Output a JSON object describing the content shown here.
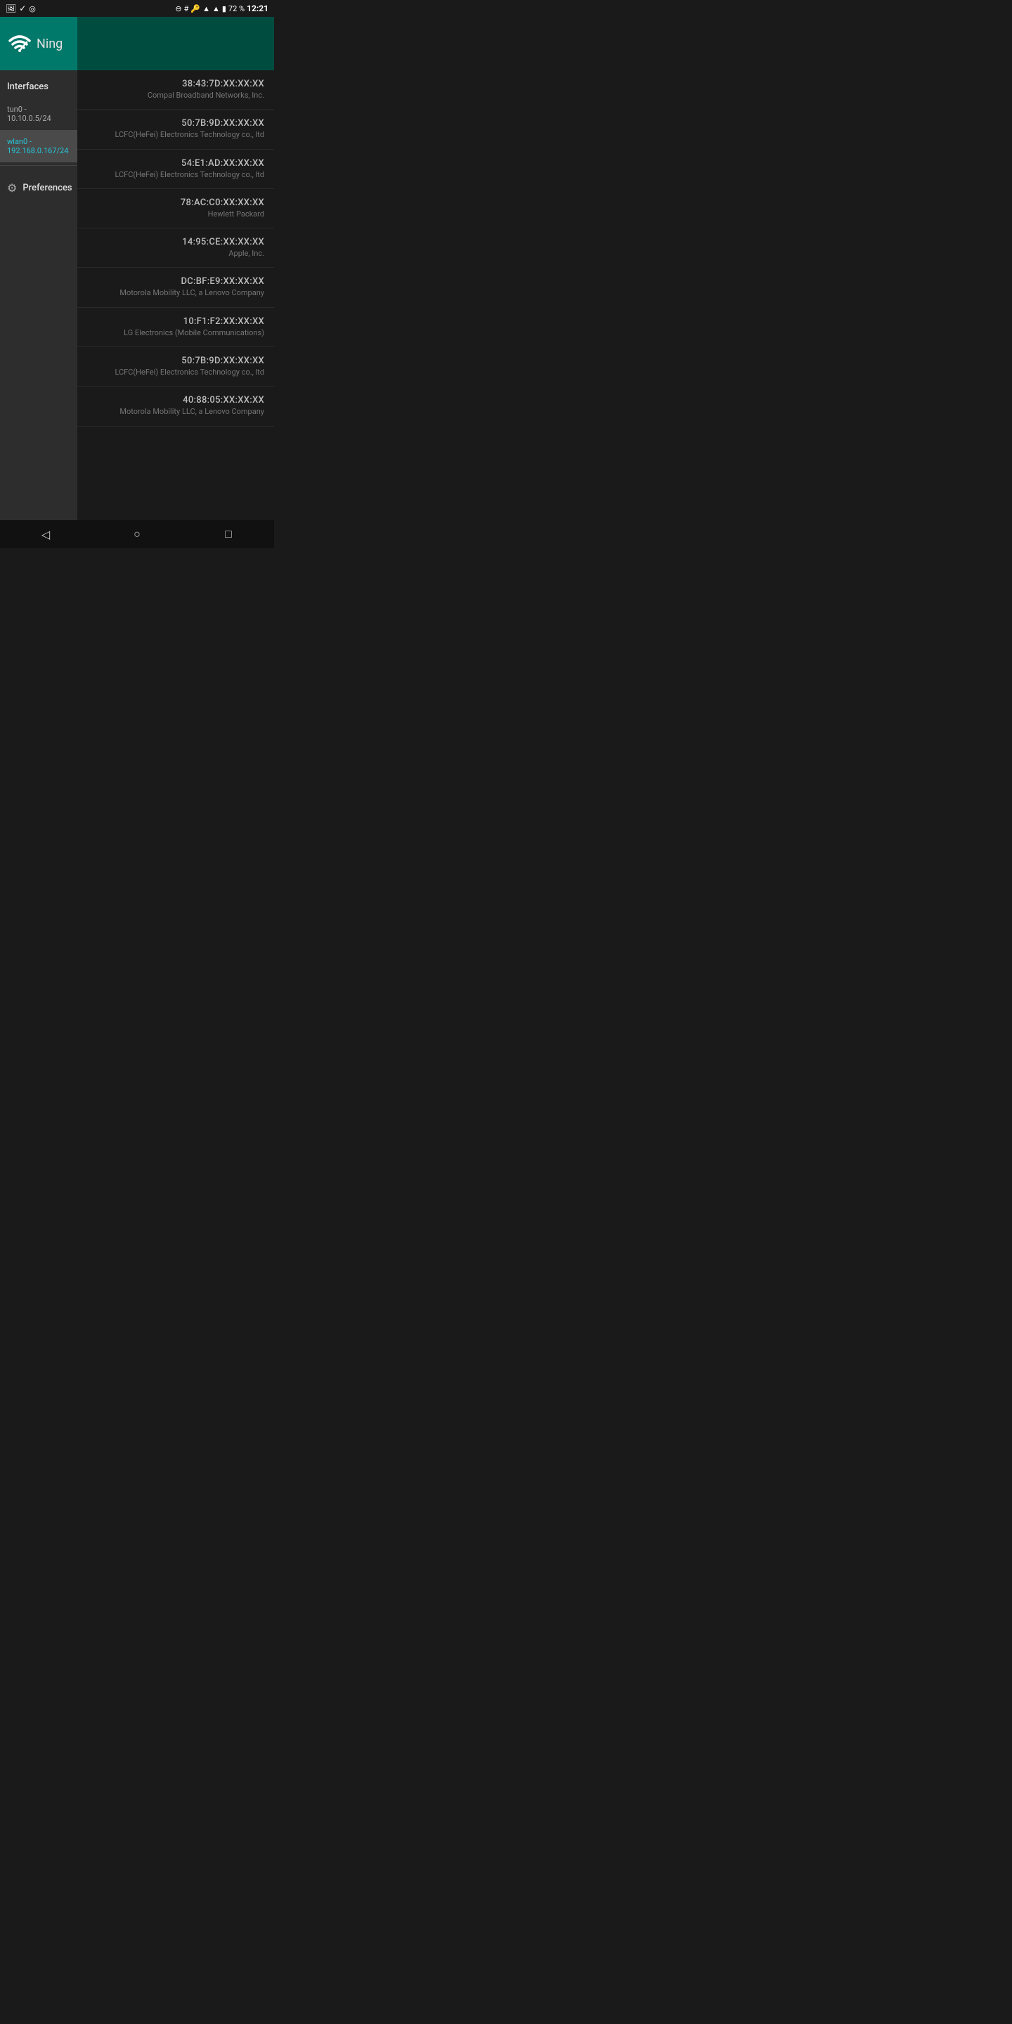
{
  "statusBar": {
    "leftIcons": [
      "image-icon",
      "check-icon",
      "target-icon"
    ],
    "rightIcons": [
      "minus-circle-icon",
      "hash-icon",
      "key-icon",
      "wifi-icon",
      "signal-icon",
      "battery-icon"
    ],
    "batteryPercent": "72 %",
    "time": "12:21"
  },
  "app": {
    "title": "Ning"
  },
  "sidebar": {
    "sectionLabel": "Interfaces",
    "items": [
      {
        "label": "tun0 - 10.10.0.5/24",
        "active": false
      },
      {
        "label": "wlan0 - 192.168.0.167/24",
        "active": true
      }
    ],
    "preferences": {
      "label": "Preferences"
    }
  },
  "devices": [
    {
      "mac": "38:43:7D:XX:XX:XX",
      "vendor": "Compal Broadband Networks, Inc."
    },
    {
      "mac": "50:7B:9D:XX:XX:XX",
      "vendor": "LCFC(HeFei) Electronics Technology co., ltd"
    },
    {
      "mac": "54:E1:AD:XX:XX:XX",
      "vendor": "LCFC(HeFei) Electronics Technology co., ltd"
    },
    {
      "mac": "78:AC:C0:XX:XX:XX",
      "vendor": "Hewlett Packard"
    },
    {
      "mac": "14:95:CE:XX:XX:XX",
      "vendor": "Apple, Inc."
    },
    {
      "mac": "DC:BF:E9:XX:XX:XX",
      "vendor": "Motorola Mobility LLC, a Lenovo Company"
    },
    {
      "mac": "10:F1:F2:XX:XX:XX",
      "vendor": "LG Electronics (Mobile Communications)"
    },
    {
      "mac": "50:7B:9D:XX:XX:XX",
      "vendor": "LCFC(HeFei) Electronics Technology co., ltd"
    },
    {
      "mac": "40:88:05:XX:XX:XX",
      "vendor": "Motorola Mobility LLC, a Lenovo Company"
    }
  ],
  "navBar": {
    "back": "◁",
    "home": "○",
    "recents": "□"
  }
}
